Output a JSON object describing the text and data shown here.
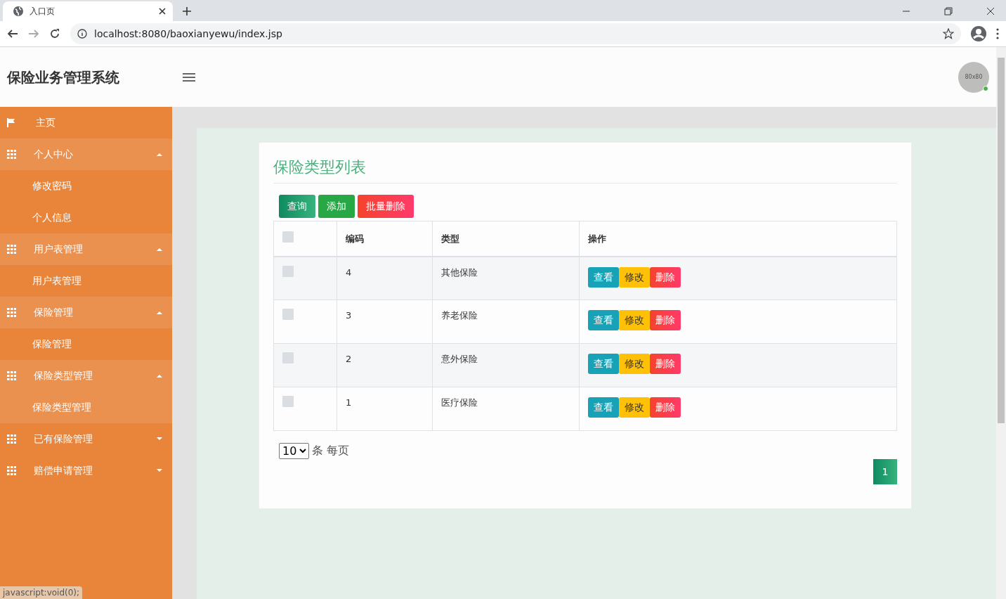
{
  "browser": {
    "tab_title": "入口页",
    "address": "localhost:8080/baoxianyewu/index.jsp",
    "status_text": "javascript:void(0);"
  },
  "header": {
    "title": "保险业务管理系统",
    "avatar_text": "80x80"
  },
  "sidebar": {
    "items": [
      {
        "kind": "link",
        "label": "主页",
        "selected": false
      },
      {
        "kind": "group",
        "label": "个人中心",
        "expanded": true,
        "children": [
          {
            "label": "修改密码",
            "selected": false
          },
          {
            "label": "个人信息",
            "selected": false
          }
        ]
      },
      {
        "kind": "group",
        "label": "用户表管理",
        "expanded": true,
        "children": [
          {
            "label": "用户表管理",
            "selected": false
          }
        ]
      },
      {
        "kind": "group",
        "label": "保险管理",
        "expanded": true,
        "children": [
          {
            "label": "保险管理",
            "selected": false
          }
        ]
      },
      {
        "kind": "group",
        "label": "保险类型管理",
        "expanded": true,
        "children": [
          {
            "label": "保险类型管理",
            "selected": true
          }
        ]
      },
      {
        "kind": "group",
        "label": "已有保险管理",
        "expanded": false
      },
      {
        "kind": "group",
        "label": "赔偿申请管理",
        "expanded": false
      }
    ]
  },
  "panel": {
    "title": "保险类型列表",
    "toolbar": [
      "查询",
      "添加",
      "批量删除"
    ],
    "table": {
      "columns": [
        "编码",
        "类型",
        "操作"
      ],
      "header_checked": false,
      "rows": [
        {
          "checked": false,
          "code": "4",
          "type": "其他保险",
          "actions": [
            "查看",
            "修改",
            "删除"
          ]
        },
        {
          "checked": false,
          "code": "3",
          "type": "养老保险",
          "actions": [
            "查看",
            "修改",
            "删除"
          ]
        },
        {
          "checked": false,
          "code": "2",
          "type": "意外保险",
          "actions": [
            "查看",
            "修改",
            "删除"
          ]
        },
        {
          "checked": false,
          "code": "1",
          "type": "医疗保险",
          "actions": [
            "查看",
            "修改",
            "删除"
          ]
        }
      ]
    },
    "page_size": "10",
    "page_size_label": "条 每页",
    "pages": [
      {
        "label": "1",
        "selected": true
      }
    ]
  }
}
